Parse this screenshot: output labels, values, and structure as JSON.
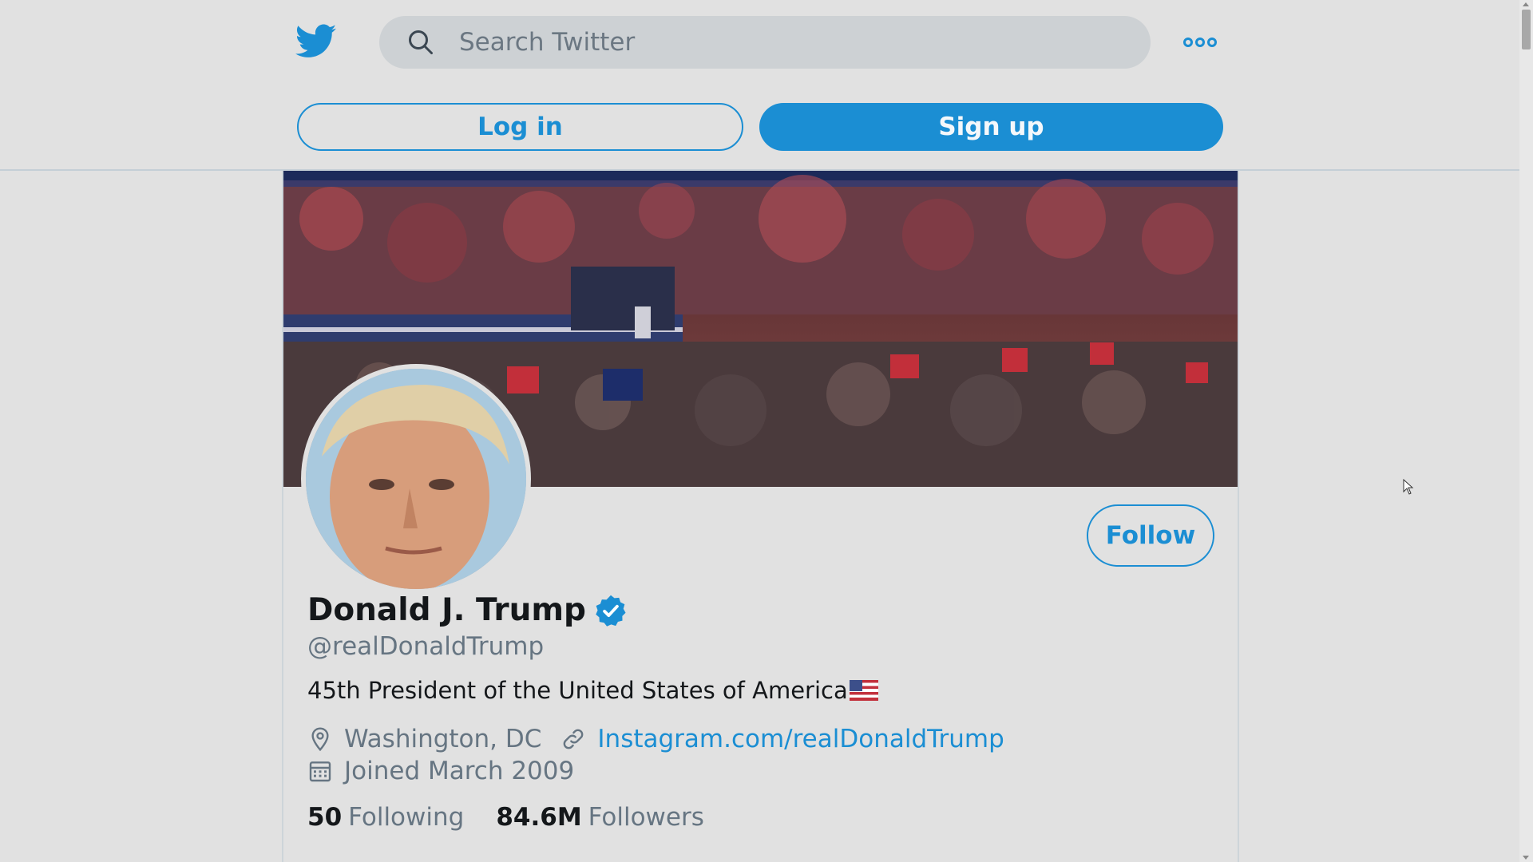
{
  "header": {
    "search_placeholder": "Search Twitter",
    "login_label": "Log in",
    "signup_label": "Sign up"
  },
  "profile": {
    "name": "Donald J. Trump",
    "handle": "@realDonaldTrump",
    "bio": "45th President of the United States of America",
    "location": "Washington, DC",
    "website": "Instagram.com/realDonaldTrump",
    "joined": "Joined March 2009",
    "following_count": "50",
    "following_label": "Following",
    "followers_count": "84.6M",
    "followers_label": "Followers",
    "follow_label": "Follow",
    "verified": true
  },
  "colors": {
    "accent": "#1b8ed3",
    "background": "#e1e1e1",
    "muted_text": "#667582"
  },
  "icons": [
    "twitter-bird-icon",
    "search-icon",
    "more-icon",
    "verified-badge-icon",
    "location-pin-icon",
    "link-icon",
    "calendar-icon",
    "flag-us-icon"
  ]
}
